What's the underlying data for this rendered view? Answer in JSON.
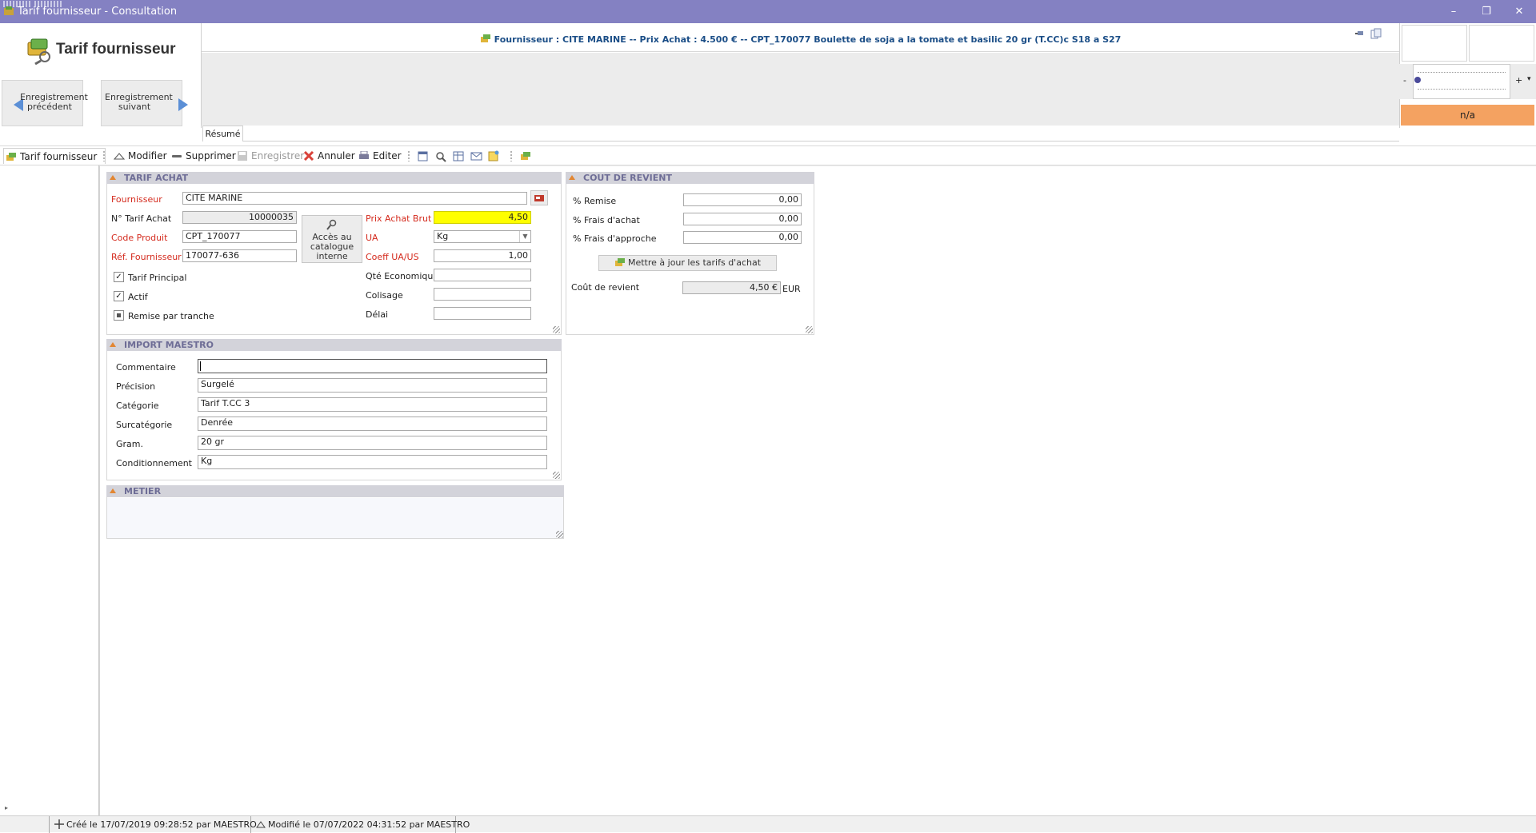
{
  "window": {
    "title_main": "Tarif fournisseur",
    "title_sub": " - Consultation",
    "minimize": "–",
    "restore": "❐",
    "close": "✕"
  },
  "header": {
    "title": "Tarif fournisseur",
    "prev_label": "Enregistrement précédent",
    "next_label": "Enregistrement suivant",
    "summary": "Fournisseur : CITE MARINE -- Prix Achat : 4.500 € --  CPT_170077 Boulette de soja a la tomate et basilic 20 gr (T.CC)c S18 a S27",
    "tab": "Résumé",
    "status_na": "n/a",
    "slider_minus": "-",
    "slider_plus": "+"
  },
  "toolbar": {
    "current": "Tarif fournisseur",
    "modifier": "Modifier",
    "supprimer": "Supprimer",
    "enregistrer": "Enregistrer",
    "annuler": "Annuler",
    "editer": "Editer"
  },
  "tarif_achat": {
    "section_title": "TARIF ACHAT",
    "fournisseur_label": "Fournisseur",
    "fournisseur_value": "CITE MARINE",
    "num_tarif_label": "N° Tarif Achat",
    "num_tarif_value": "10000035",
    "code_produit_label": "Code Produit",
    "code_produit_value": "CPT_170077",
    "ref_fournisseur_label": "Réf. Fournisseur",
    "ref_fournisseur_value": "170077-636",
    "catalogue_button": "Accès au catalogue interne",
    "prix_achat_label": "Prix Achat Brut",
    "prix_achat_value": "4,50",
    "ua_label": "UA",
    "ua_value": "Kg",
    "coeff_label": "Coeff UA/US",
    "coeff_value": "1,00",
    "qte_eco_label": "Qté Economique",
    "qte_eco_value": "",
    "colisage_label": "Colisage",
    "colisage_value": "",
    "delai_label": "Délai",
    "delai_value": "",
    "tarif_principal_label": "Tarif Principal",
    "tarif_principal_checked": true,
    "actif_label": "Actif",
    "actif_checked": true,
    "remise_tranche_label": "Remise par tranche",
    "remise_tranche_state": "indeterminate"
  },
  "cout_revient": {
    "section_title": "COUT DE REVIENT",
    "remise_label": "% Remise",
    "remise_value": "0,00",
    "frais_achat_label": "% Frais d'achat",
    "frais_achat_value": "0,00",
    "frais_approche_label": "% Frais d'approche",
    "frais_approche_value": "0,00",
    "update_button": "Mettre à jour les tarifs d'achat",
    "cout_label": "Coût de revient",
    "cout_value": "4,50 €",
    "currency": "EUR"
  },
  "import_maestro": {
    "section_title": "IMPORT MAESTRO",
    "commentaire_label": "Commentaire",
    "commentaire_value": "",
    "precision_label": "Précision",
    "precision_value": "Surgelé",
    "categorie_label": "Catégorie",
    "categorie_value": "Tarif T.CC 3",
    "surcategorie_label": "Surcatégorie",
    "surcategorie_value": "Denrée",
    "gram_label": "Gram.",
    "gram_value": "20 gr",
    "conditionnement_label": "Conditionnement",
    "conditionnement_value": "Kg"
  },
  "metier": {
    "section_title": "METIER"
  },
  "statusbar": {
    "created": "Créé le 17/07/2019 09:28:52 par MAESTRO",
    "modified": "Modifié le 07/07/2022 04:31:52 par MAESTRO"
  },
  "colors": {
    "titlebar": "#8481c2",
    "section_head": "#d3d3da",
    "highlight": "#ffff00",
    "na_badge": "#f4a261",
    "required_label": "#d42a1d"
  }
}
